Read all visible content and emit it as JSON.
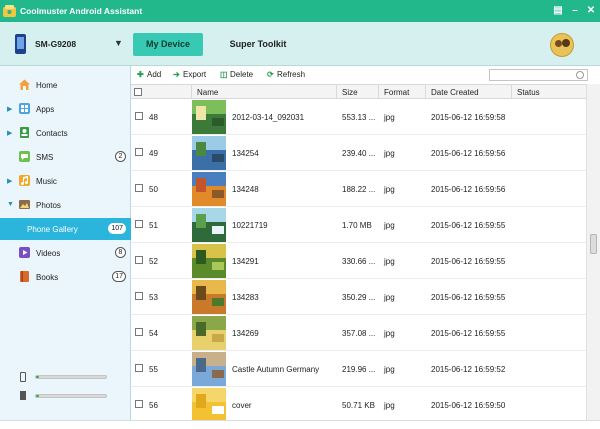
{
  "window": {
    "title": "Coolmuster Android Assistant",
    "controls": [
      "save-window-icon",
      "minimize-icon",
      "close-icon"
    ],
    "accent_color": "#23b88c"
  },
  "header": {
    "device_name": "SM-G9208",
    "tabs": [
      {
        "label": "My Device",
        "active": true
      },
      {
        "label": "Super Toolkit",
        "active": false
      }
    ]
  },
  "sidebar": {
    "items": [
      {
        "label": "Home",
        "icon": "home-icon",
        "count": "",
        "expandable": false
      },
      {
        "label": "Apps",
        "icon": "apps-icon",
        "count": "",
        "expandable": true
      },
      {
        "label": "Contacts",
        "icon": "contacts-icon",
        "count": "",
        "expandable": true
      },
      {
        "label": "SMS",
        "icon": "sms-icon",
        "count": "2",
        "expandable": false
      },
      {
        "label": "Music",
        "icon": "music-icon",
        "count": "",
        "expandable": true
      },
      {
        "label": "Photos",
        "icon": "photos-icon",
        "count": "",
        "expandable": true,
        "expanded": true
      },
      {
        "label": "Phone Gallery",
        "icon": "",
        "count": "107",
        "expandable": false,
        "active": true
      },
      {
        "label": "Videos",
        "icon": "videos-icon",
        "count": "8",
        "expandable": false
      },
      {
        "label": "Books",
        "icon": "books-icon",
        "count": "17",
        "expandable": false
      }
    ],
    "storage": [
      {
        "icon": "phone-storage-icon",
        "used_fraction": 0.02
      },
      {
        "icon": "sd-card-icon",
        "used_fraction": 0.02
      }
    ]
  },
  "toolbar": {
    "add": "Add",
    "export": "Export",
    "delete": "Delete",
    "refresh": "Refresh",
    "search_placeholder": ""
  },
  "table": {
    "columns": [
      "Name",
      "Size",
      "Format",
      "Date Created",
      "Status"
    ],
    "rows": [
      {
        "num": "48",
        "name": "2012-03-14_092031",
        "size": "553.13 ...",
        "format": "jpg",
        "date": "2015-06-12 16:59:58",
        "status": "",
        "thumb": "landscape"
      },
      {
        "num": "49",
        "name": "134254",
        "size": "239.40 ...",
        "format": "jpg",
        "date": "2015-06-12 16:59:56",
        "status": "",
        "thumb": "lake"
      },
      {
        "num": "50",
        "name": "134248",
        "size": "188.22 ...",
        "format": "jpg",
        "date": "2015-06-12 16:59:56",
        "status": "",
        "thumb": "autumn-lake"
      },
      {
        "num": "51",
        "name": "10221719",
        "size": "1.70 MB",
        "format": "jpg",
        "date": "2015-06-12 16:59:55",
        "status": "",
        "thumb": "waterfall"
      },
      {
        "num": "52",
        "name": "134291",
        "size": "330.66 ...",
        "format": "jpg",
        "date": "2015-06-12 16:59:55",
        "status": "",
        "thumb": "forest"
      },
      {
        "num": "53",
        "name": "134283",
        "size": "350.29 ...",
        "format": "jpg",
        "date": "2015-06-12 16:59:55",
        "status": "",
        "thumb": "autumn-trees"
      },
      {
        "num": "54",
        "name": "134269",
        "size": "357.08 ...",
        "format": "jpg",
        "date": "2015-06-12 16:59:55",
        "status": "",
        "thumb": "sunlit-path"
      },
      {
        "num": "55",
        "name": "Castle Autumn Germany",
        "size": "219.96 ...",
        "format": "jpg",
        "date": "2015-06-12 16:59:52",
        "status": "",
        "thumb": "castle"
      },
      {
        "num": "56",
        "name": "cover",
        "size": "50.71 KB",
        "format": "jpg",
        "date": "2015-06-12 16:59:50",
        "status": "",
        "thumb": "book-cover"
      }
    ]
  }
}
